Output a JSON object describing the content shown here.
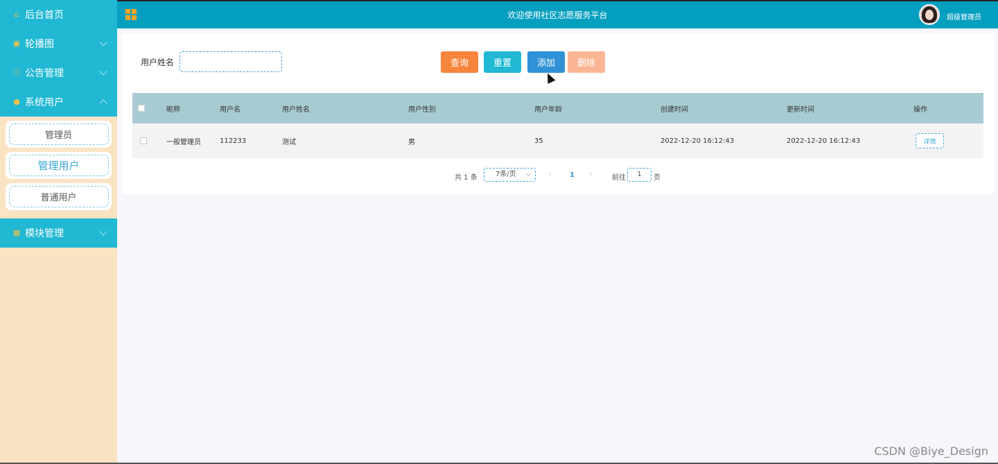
{
  "header": {
    "title": "欢迎使用社区志愿服务平台",
    "user": "超级管理员"
  },
  "sidebar": {
    "items": [
      {
        "label": "后台首页",
        "icon": "home-icon"
      },
      {
        "label": "轮播图",
        "icon": "image-icon"
      },
      {
        "label": "公告管理",
        "icon": "info-icon"
      },
      {
        "label": "系统用户",
        "icon": "user-icon"
      },
      {
        "label": "模块管理",
        "icon": "grid-icon"
      }
    ],
    "sub_items": [
      "管理员",
      "管理用户",
      "普通用户"
    ],
    "active_sub": "管理用户"
  },
  "search": {
    "label": "用户姓名",
    "value": ""
  },
  "buttons": {
    "query": "查询",
    "reset": "重置",
    "add": "添加",
    "delete": "删除"
  },
  "table": {
    "columns": [
      "昵称",
      "用户名",
      "用户姓名",
      "用户性别",
      "用户年龄",
      "创建时间",
      "更新时间",
      "操作"
    ],
    "rows": [
      [
        "一般管理员",
        "112233",
        "测试",
        "男",
        "35",
        "2022-12-20 16:12:43",
        "2022-12-20 16:12:43",
        "详情"
      ]
    ]
  },
  "pagination": {
    "total": "共 1 条",
    "page_size": "7条/页",
    "current": "1",
    "goto_label": "前往",
    "goto_value": "1",
    "goto_suffix": "页"
  },
  "watermark": "CSDN @Biye_Design",
  "colors": {
    "header": "#049fbf",
    "menu": "#20b8d3",
    "sidebar_bg": "#f9e3c2",
    "query": "#f7853c",
    "reset": "#20b8d3",
    "add": "#2f92d6",
    "delete": "#f9b594",
    "table_header": "#a8cbd2"
  }
}
